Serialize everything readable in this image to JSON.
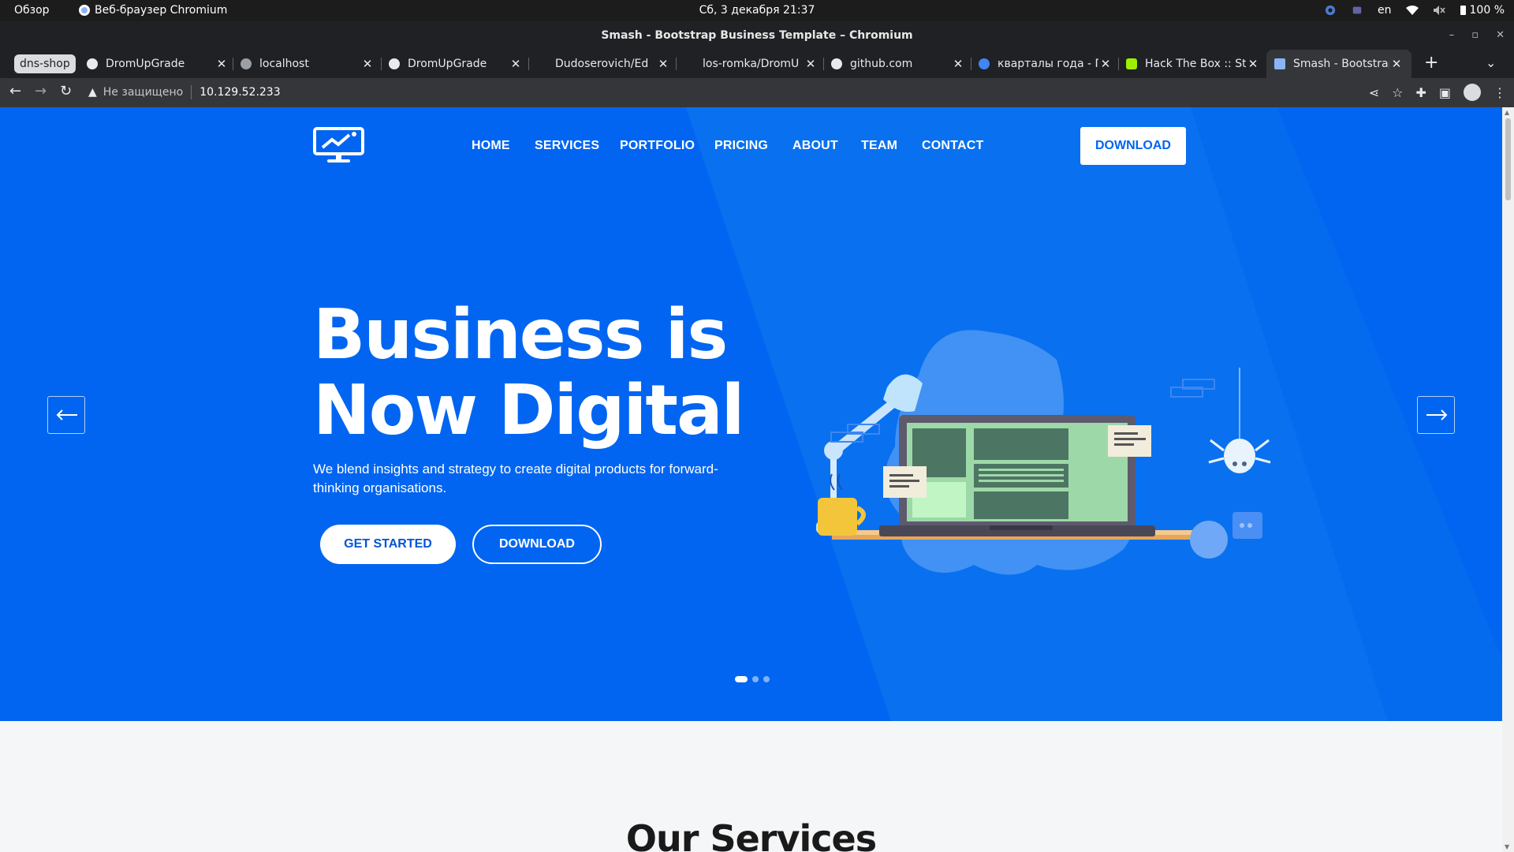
{
  "system": {
    "overview": "Обзор",
    "app_name": "Веб-браузер Chromium",
    "clock": "Сб, 3 декабря  21:37",
    "lang": "en",
    "battery": "100 %"
  },
  "window": {
    "title": "Smash - Bootstrap Business Template – Chromium"
  },
  "tabs": {
    "group": "dns-shop",
    "items": [
      {
        "label": "DromUpGrade",
        "color": "#e8eaed"
      },
      {
        "label": "localhost",
        "color": "#9aa0a6"
      },
      {
        "label": "DromUpGrade",
        "color": "#e8eaed"
      },
      {
        "label": "Dudoserovich/Ed",
        "color": "#202124"
      },
      {
        "label": "los-romka/DromU",
        "color": "#202124"
      },
      {
        "label": "github.com",
        "color": "#e8eaed"
      },
      {
        "label": "кварталы года - П",
        "color": "#4285f4"
      },
      {
        "label": "Hack The Box :: St",
        "color": "#9fef00"
      },
      {
        "label": "Smash - Bootstrap",
        "color": "#8ab4f8"
      }
    ]
  },
  "toolbar": {
    "security": "Не защищено",
    "url": "10.129.52.233"
  },
  "site": {
    "nav": [
      "HOME",
      "SERVICES",
      "PORTFOLIO",
      "PRICING",
      "ABOUT",
      "TEAM",
      "CONTACT"
    ],
    "download_top": "DOWNLOAD",
    "headline_line1": "Business is",
    "headline_line2": "Now Digital",
    "subtitle": "We blend insights and strategy to create digital products for forward-thinking organisations.",
    "btn_get_started": "GET STARTED",
    "btn_download": "DOWNLOAD",
    "slides": {
      "count": 3,
      "active": 1
    },
    "services_title": "Our Services",
    "colors": {
      "hero": "#0165f1",
      "accent": "#ffffff"
    }
  }
}
